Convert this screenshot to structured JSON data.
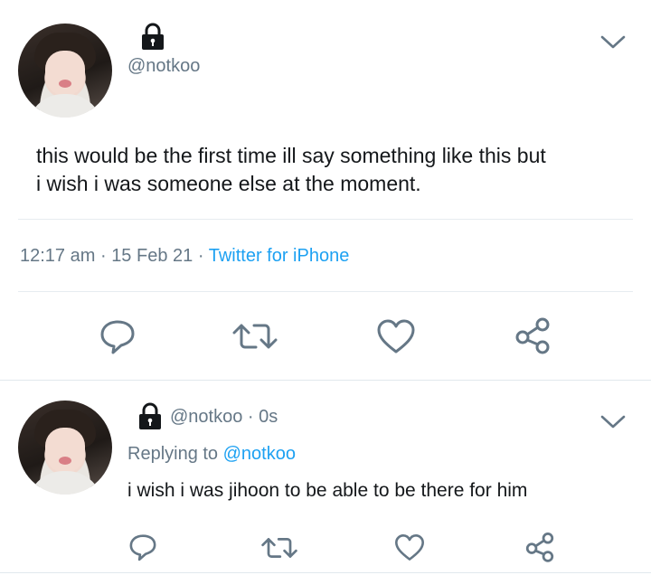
{
  "main_tweet": {
    "handle": "@notkoo",
    "text_line1": "this would be the first time ill say something like this but",
    "text_line2": "i wish i was someone else at the moment.",
    "time": "12:17 am",
    "sep1": "·",
    "date": "15 Feb 21",
    "sep2": "·",
    "client": "Twitter for iPhone"
  },
  "reply_tweet": {
    "handle": "@notkoo",
    "sep": "·",
    "age": "0s",
    "replying_prefix": "Replying to",
    "replying_to": "@notkoo",
    "text": "i wish i was jihoon to be able to be there for him"
  },
  "icons": [
    "lock-icon",
    "chevron-down-icon",
    "reply-icon",
    "retweet-icon",
    "like-icon",
    "share-icon"
  ],
  "colors": {
    "link": "#1da1f2",
    "muted": "#657786",
    "text": "#14171a",
    "icon": "#657786"
  }
}
